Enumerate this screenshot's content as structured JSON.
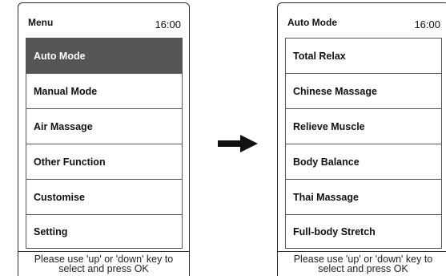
{
  "left_screen": {
    "title": "Menu",
    "clock": "16:00",
    "items": [
      {
        "label": "Auto Mode"
      },
      {
        "label": "Manual Mode"
      },
      {
        "label": "Air Massage"
      },
      {
        "label": "Other Function"
      },
      {
        "label": "Customise"
      },
      {
        "label": "Setting"
      }
    ],
    "selected_index": 0,
    "hint_line1": "Please use 'up' or 'down' key to",
    "hint_line2": "select and press OK"
  },
  "arrow_icon": "right-arrow-icon",
  "right_screen": {
    "title": "Auto Mode",
    "clock": "16:00",
    "items": [
      {
        "label": "Total Relax"
      },
      {
        "label": "Chinese Massage"
      },
      {
        "label": "Relieve Muscle"
      },
      {
        "label": "Body Balance"
      },
      {
        "label": "Thai Massage"
      },
      {
        "label": "Full-body Stretch"
      }
    ],
    "hint_line1": "Please use 'up' or 'down' key to",
    "hint_line2": "select and press OK"
  },
  "colors": {
    "selected_bg": "#555555",
    "selected_text": "#ffffff",
    "border": "#2b2b2b"
  }
}
